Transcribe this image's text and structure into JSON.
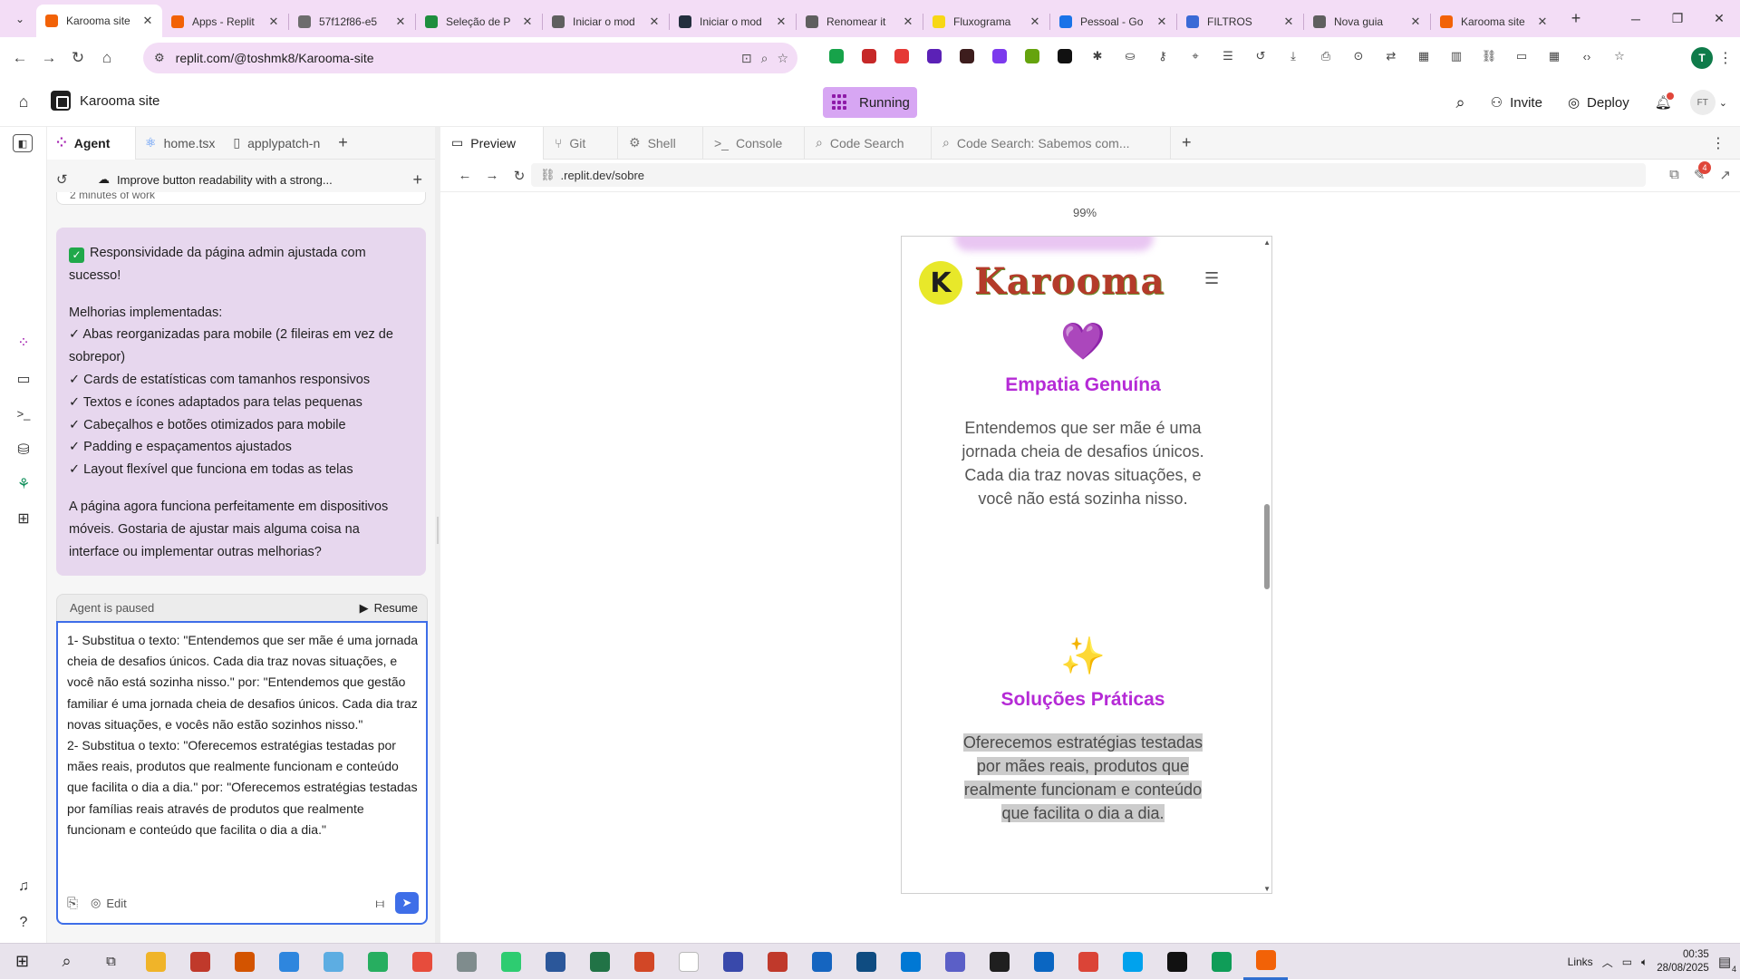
{
  "browser": {
    "tabs": [
      {
        "title": "Karooma site",
        "color": "#f26207",
        "active": true
      },
      {
        "title": "Apps - Replit",
        "color": "#f26207",
        "active": false
      },
      {
        "title": "57f12f86-e5",
        "color": "#6d6d6d",
        "active": false
      },
      {
        "title": "Seleção de P",
        "color": "#1e8e3e",
        "active": false
      },
      {
        "title": "Iniciar o mod",
        "color": "#5f5f5f",
        "active": false
      },
      {
        "title": "Iniciar o mod",
        "color": "#232f3e",
        "active": false
      },
      {
        "title": "Renomear it",
        "color": "#5f5f5f",
        "active": false
      },
      {
        "title": "Fluxograma",
        "color": "#f7d716",
        "active": false
      },
      {
        "title": "Pessoal - Go",
        "color": "#1a73e8",
        "active": false
      },
      {
        "title": "FILTROS",
        "color": "#3a6ad6",
        "active": false
      },
      {
        "title": "Nova guia",
        "color": "#5f5f5f",
        "active": false
      },
      {
        "title": "Karooma site",
        "color": "#f26207",
        "active": false
      }
    ],
    "url": "replit.com/@toshmk8/Karooma-site",
    "profile_initial": "T",
    "extensions": [
      "#17a34a",
      "#c62828",
      "#e53935",
      "#5b21b6",
      "#3d1d1d",
      "#7c3aed",
      "#65a30d",
      "#111111"
    ]
  },
  "replit": {
    "project_name": "Karooma site",
    "run_status": "Running",
    "invite_label": "Invite",
    "deploy_label": "Deploy",
    "avatar_initials": "FT",
    "left_tabs": [
      "Agent",
      "home.tsx",
      "applypatch-n"
    ],
    "thread_title": "Improve button readability with a strong...",
    "worklog": "2 minutes of work",
    "agent_message": {
      "heading": "Responsividade da página admin ajustada com sucesso!",
      "subheading": "Melhorias implementadas:",
      "items": [
        "✓ Abas reorganizadas para mobile (2 fileiras em vez de sobrepor)",
        "✓ Cards de estatísticas com tamanhos responsivos",
        "✓ Textos e ícones adaptados para telas pequenas",
        "✓ Cabeçalhos e botões otimizados para mobile",
        "✓ Padding e espaçamentos ajustados",
        "✓ Layout flexível que funciona em todas as telas"
      ],
      "closing": "A página agora funciona perfeitamente em dispositivos móveis. Gostaria de ajustar mais alguma coisa na interface ou implementar outras melhorias?"
    },
    "paused_label": "Agent is paused",
    "resume_label": "Resume",
    "composer_text": "1- Substitua o texto: \"Entendemos que ser mãe é uma jornada cheia de desafios únicos. Cada dia traz novas situações, e você não está sozinha nisso.\" por: \"Entendemos que gestão familiar é uma jornada cheia de desafios únicos. Cada dia traz novas situações, e vocês não estão sozinhos nisso.\"\n2- Substitua o texto: \"Oferecemos estratégias testadas por mães reais, produtos que realmente funcionam e conteúdo que facilita o dia a dia.\" por: \"Oferecemos estratégias testadas por famílias reais através de produtos que realmente funcionam e conteúdo que facilita o dia a dia.\"",
    "edit_label": "Edit",
    "right_tabs": [
      "Preview",
      "Git",
      "Shell",
      "Console",
      "Code Search",
      "Code Search: Sabemos com..."
    ],
    "preview_url": ".replit.dev/sobre",
    "notif_count": "4",
    "zoom": "99%"
  },
  "site": {
    "brand": "Karooma",
    "brand_initial": "K",
    "features": [
      {
        "icon": "💜",
        "title": "Empatia Genuína",
        "desc": "Entendemos que ser mãe é uma jornada cheia de desafios únicos. Cada dia traz novas situações, e você não está sozinha nisso."
      },
      {
        "icon": "✨",
        "title": "Soluções Práticas",
        "desc": "Oferecemos estratégias testadas por mães reais, produtos que realmente funcionam e conteúdo que facilita o dia a dia."
      }
    ]
  },
  "taskbar": {
    "apps": [
      "#f0b429",
      "#c0392b",
      "#d35400",
      "#2e86de",
      "#5dade2",
      "#27ae60",
      "#e74c3c",
      "#7f8c8d",
      "#2ecc71",
      "#2b579a",
      "#217346",
      "#d24726",
      "#ffffff",
      "#3949ab",
      "#c0392b",
      "#1565c0",
      "#0f4c81",
      "#0078d4",
      "#5b5fc7",
      "#1f1f1f",
      "#0a66c2",
      "#db4437",
      "#00a2ed",
      "#111111",
      "#0f9d58",
      "#f26207"
    ],
    "links_label": "Links",
    "time": "00:35",
    "date": "28/08/2025",
    "notif_count": "4"
  }
}
